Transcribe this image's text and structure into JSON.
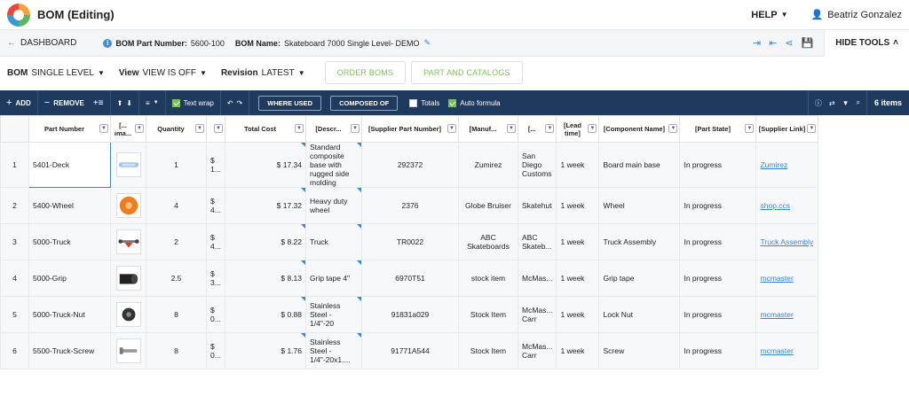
{
  "app": {
    "title": "BOM (Editing)",
    "help": "HELP",
    "user": "Beatriz Gonzalez"
  },
  "subheader": {
    "back": "DASHBOARD",
    "part_number_label": "BOM Part Number:",
    "part_number": "5600-100",
    "bom_name_label": "BOM Name:",
    "bom_name": "Skateboard 7000 Single Level- DEMO",
    "hide_tools": "HIDE TOOLS"
  },
  "controls": {
    "bom_label": "BOM",
    "bom_value": "SINGLE LEVEL",
    "view_label": "View",
    "view_value": "VIEW IS OFF",
    "revision_label": "Revision",
    "revision_value": "LATEST",
    "order_boms": "ORDER BOMS",
    "part_catalogs": "PART AND CATALOGS"
  },
  "toolbar": {
    "add": "ADD",
    "remove": "REMOVE",
    "text_wrap": "Text wrap",
    "where_used": "WHERE USED",
    "composed_of": "COMPOSED OF",
    "totals": "Totals",
    "auto_formula": "Auto formula",
    "items_count": "6 items"
  },
  "columns": [
    "Part Number",
    "[... ima...",
    "Quantity",
    "",
    "Total Cost",
    "[Descr...",
    "[Supplier Part Number]",
    "[Manuf...",
    "[...",
    "[Lead time]",
    "[Component Name]",
    "[Part State]",
    "[Supplier Link]"
  ],
  "rows": [
    {
      "idx": "1",
      "part": "5401-Deck",
      "qty": "1",
      "unit": "$ 1...",
      "total": "$ 17.34",
      "desc": "Standard composite base with rugged side molding",
      "spn": "292372",
      "manuf": "Zumirez",
      "loc": "San Diego Customs",
      "lead": "1 week",
      "comp": "Board main base",
      "state": "In progress",
      "link": "Zumirez"
    },
    {
      "idx": "2",
      "part": "5400-Wheel",
      "qty": "4",
      "unit": "$ 4...",
      "total": "$ 17.32",
      "desc": "Heavy duty wheel",
      "spn": "2376",
      "manuf": "Globe Bruiser",
      "loc": "Skatehut",
      "lead": "1 week",
      "comp": "Wheel",
      "state": "In progress",
      "link": "shop.ccs"
    },
    {
      "idx": "3",
      "part": "5000-Truck",
      "qty": "2",
      "unit": "$ 4...",
      "total": "$ 8.22",
      "desc": "Truck",
      "spn": "TR0022",
      "manuf": "ABC Skateboards",
      "loc": "ABC Skateb...",
      "lead": "1 week",
      "comp": "Truck Assembly",
      "state": "In progress",
      "link": "Truck Assembly"
    },
    {
      "idx": "4",
      "part": "5000-Grip",
      "qty": "2.5",
      "unit": "$ 3...",
      "total": "$ 8.13",
      "desc": "Grip tape 4\"",
      "spn": "6970T51",
      "manuf": "stock item",
      "loc": "McMas...",
      "lead": "1 week",
      "comp": "Grip tape",
      "state": "In progress",
      "link": "mcmaster"
    },
    {
      "idx": "5",
      "part": "5000-Truck-Nut",
      "qty": "8",
      "unit": "$ 0...",
      "total": "$ 0.88",
      "desc": "Stainless Steel - 1/4\"-20",
      "spn": "91831a029",
      "manuf": "Stock Item",
      "loc": "McMas... Carr",
      "lead": "1 week",
      "comp": "Lock Nut",
      "state": "In progress",
      "link": "mcmaster"
    },
    {
      "idx": "6",
      "part": "5500-Truck-Screw",
      "qty": "8",
      "unit": "$ 0...",
      "total": "$ 1.76",
      "desc": "Stainless Steel - 1/4\"-20x1....",
      "spn": "91771A544",
      "manuf": "Stock Item",
      "loc": "McMas... Carr",
      "lead": "1 week",
      "comp": "Screw",
      "state": "In progress",
      "link": "mcmaster"
    }
  ]
}
